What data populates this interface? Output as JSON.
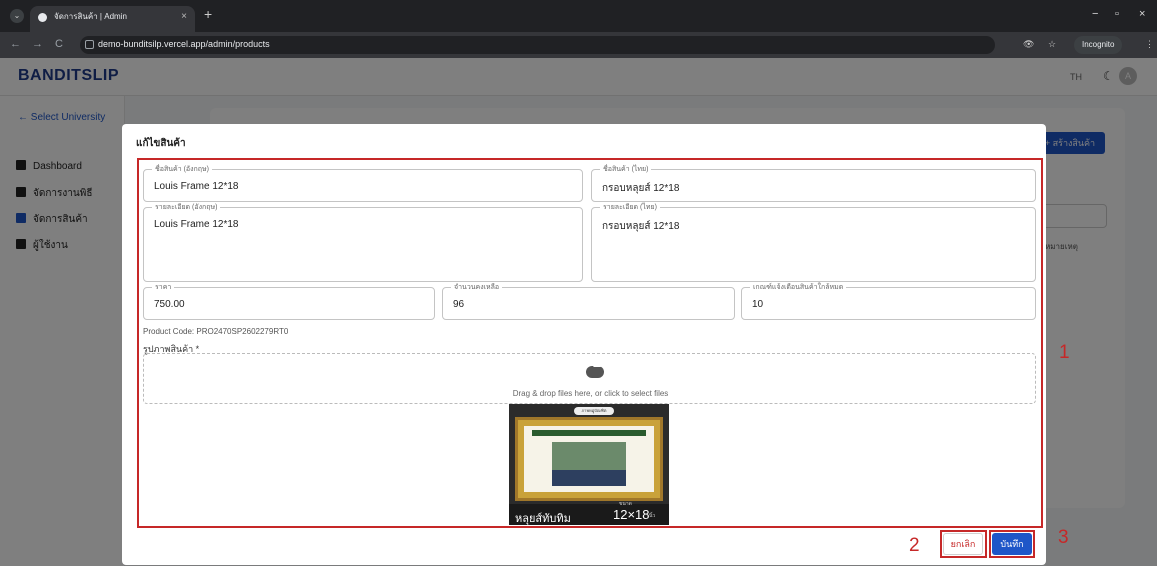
{
  "browser": {
    "tab_title": "จัดการสินค้า | Admin",
    "tab_close": "×",
    "new_tab": "+",
    "url": "demo-bunditsilp.vercel.app/admin/products",
    "incognito_label": "Incognito",
    "minimize": "−",
    "maximize": "▫",
    "close": "×",
    "back": "←",
    "forward": "→",
    "reload": "C",
    "menu": "⋮",
    "eye": "👁",
    "star": "☆"
  },
  "app": {
    "brand": "BANDITSLIP",
    "lang": "TH",
    "avatar_letter": "A"
  },
  "sidebar": {
    "back_label": "← Select University",
    "items": [
      {
        "label": "Dashboard"
      },
      {
        "label": "จัดการงานพิธี"
      },
      {
        "label": "จัดการสินค้า"
      },
      {
        "label": "ผู้ใช้งาน"
      }
    ]
  },
  "background": {
    "create_button": "+ สร้างสินค้า",
    "column_header": "หมายเหตุ"
  },
  "modal": {
    "title": "แก้ไขสินค้า",
    "fields": {
      "name_en": {
        "label": "ชื่อสินค้า (อังกฤษ)",
        "value": "Louis Frame 12*18"
      },
      "name_th": {
        "label": "ชื่อสินค้า (ไทย)",
        "value": "กรอบหลุยส์ 12*18"
      },
      "desc_en": {
        "label": "รายละเอียด (อังกฤษ)",
        "value": "Louis Frame  12*18"
      },
      "desc_th": {
        "label": "รายละเอียด (ไทย)",
        "value": "กรอบหลุยส์ 12*18"
      },
      "price": {
        "label": "ราคา",
        "value": "750.00"
      },
      "stock": {
        "label": "จำนวนคงเหลือ",
        "value": "96"
      },
      "threshold": {
        "label": "เกณฑ์แจ้งเตือนสินค้าใกล้หมด",
        "value": "10"
      }
    },
    "product_code": "Product Code: PRO2470SP2602279RT0",
    "image_label": "รูปภาพสินค้า *",
    "dropzone_text": "Drag & drop files here, or click to select files",
    "thumbnail": {
      "header": "ภาพหมู่บัณฑิต",
      "caption_left": "หลุยส์ทับทิม",
      "caption_size_label": "ขนาด",
      "caption_size": "12×18",
      "caption_unit": "นิ้ว"
    },
    "cancel_label": "ยกเลิก",
    "save_label": "บันทึก"
  },
  "annotations": {
    "n1": "1",
    "n2": "2",
    "n3": "3"
  }
}
